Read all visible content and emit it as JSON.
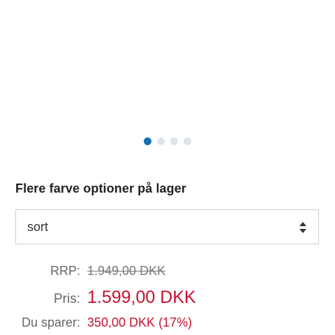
{
  "gallery": {
    "dots_total": 4,
    "active_index": 0
  },
  "options": {
    "title": "Flere farve optioner på lager",
    "selected": "sort"
  },
  "pricing": {
    "rrp_label": "RRP:",
    "rrp_value": "1.949,00 DKK",
    "price_label": "Pris:",
    "price_value": "1.599,00 DKK",
    "save_label": "Du sparer:",
    "save_value": "350,00 DKK (17%)"
  },
  "colors": {
    "accent": "#1570b8",
    "price": "#c8102e"
  }
}
